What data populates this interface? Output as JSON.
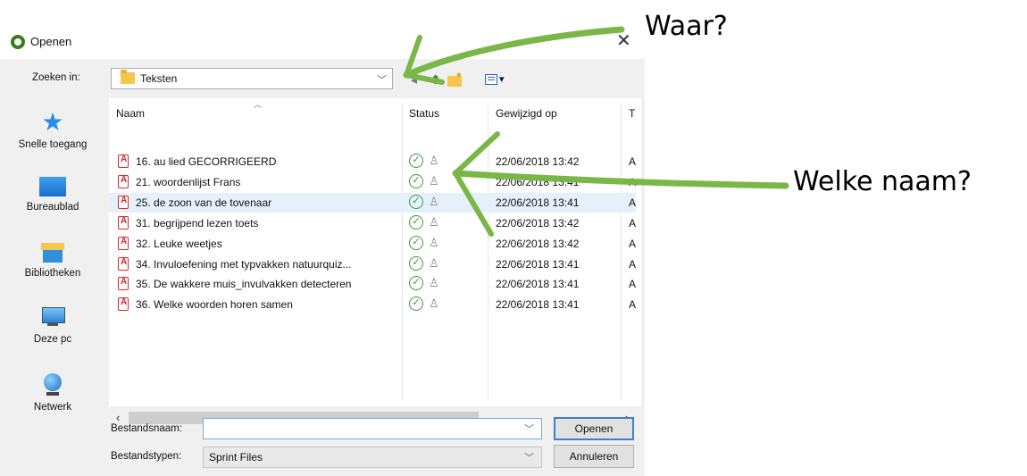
{
  "dialog": {
    "title": "Openen",
    "lookin_label": "Zoeken in:",
    "lookin_value": "Teksten",
    "columns": [
      "Naam",
      "Status",
      "Gewijzigd op",
      "T"
    ],
    "files": [
      {
        "name": "16. au lied GECORRIGEERD",
        "date": "22/06/2018 13:42",
        "type": "A"
      },
      {
        "name": "21. woordenlijst Frans",
        "date": "22/06/2018 13:41",
        "type": "A"
      },
      {
        "name": "25. de zoon van de tovenaar",
        "date": "22/06/2018 13:41",
        "type": "A"
      },
      {
        "name": "31. begrijpend lezen toets",
        "date": "22/06/2018 13:42",
        "type": "A"
      },
      {
        "name": "32. Leuke weetjes",
        "date": "22/06/2018 13:42",
        "type": "A"
      },
      {
        "name": "34. Invuloefening met typvakken natuurquiz...",
        "date": "22/06/2018 13:41",
        "type": "A"
      },
      {
        "name": "35. De wakkere muis_invulvakken detecteren",
        "date": "22/06/2018 13:41",
        "type": "A"
      },
      {
        "name": "36. Welke woorden horen samen",
        "date": "22/06/2018 13:41",
        "type": "A"
      }
    ],
    "selected_index": 2,
    "places": [
      "Snelle toegang",
      "Bureaublad",
      "Bibliotheken",
      "Deze pc",
      "Netwerk"
    ],
    "filename_label": "Bestandsnaam:",
    "filename_value": "",
    "filetype_label": "Bestandstypen:",
    "filetype_value": "Sprint Files",
    "open_button": "Openen",
    "cancel_button": "Annuleren"
  },
  "annotations": {
    "where": "Waar?",
    "which_name": "Welke naam?"
  },
  "colors": {
    "arrow_green": "#7ab648",
    "selection": "#e5f0fb",
    "primary_border": "#3c7fd4"
  }
}
